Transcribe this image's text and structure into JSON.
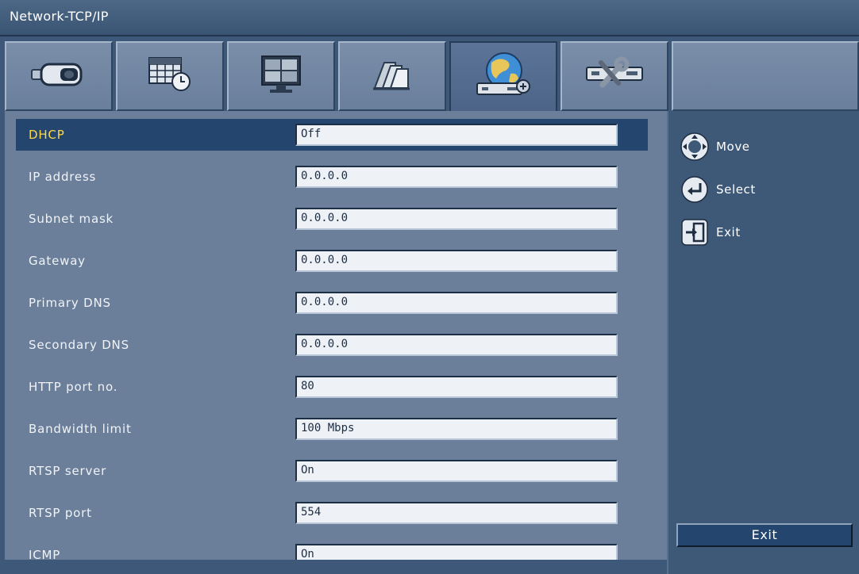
{
  "window": {
    "title": "Network-TCP/IP"
  },
  "tabs": [
    {
      "icon": "camera-icon",
      "active": false
    },
    {
      "icon": "schedule-clock-icon",
      "active": false
    },
    {
      "icon": "monitor-icon",
      "active": false
    },
    {
      "icon": "recording-archive-icon",
      "active": false
    },
    {
      "icon": "network-globe-icon",
      "active": true
    },
    {
      "icon": "system-tools-icon",
      "active": false
    }
  ],
  "settings": [
    {
      "label": "DHCP",
      "value": "Off",
      "selected": true
    },
    {
      "label": "IP address",
      "value": "0.0.0.0"
    },
    {
      "label": "Subnet mask",
      "value": "0.0.0.0"
    },
    {
      "label": "Gateway",
      "value": "0.0.0.0"
    },
    {
      "label": "Primary DNS",
      "value": "0.0.0.0"
    },
    {
      "label": "Secondary DNS",
      "value": "0.0.0.0"
    },
    {
      "label": "HTTP port no.",
      "value": "80"
    },
    {
      "label": "Bandwidth limit",
      "value": "100 Mbps"
    },
    {
      "label": "RTSP server",
      "value": "On"
    },
    {
      "label": "RTSP port",
      "value": "554"
    },
    {
      "label": "ICMP",
      "value": "On"
    }
  ],
  "help": {
    "move": {
      "icon": "dpad-icon",
      "label": "Move"
    },
    "select": {
      "icon": "enter-icon",
      "label": "Select"
    },
    "exit": {
      "icon": "exit-door-icon",
      "label": "Exit"
    }
  },
  "exit_button": {
    "label": "Exit"
  },
  "colors": {
    "background": "#3d5878",
    "panel": "#6b7f9a",
    "selected_row": "#24466e",
    "selected_text": "#ffd84a",
    "field_bg": "#eef2f7"
  }
}
